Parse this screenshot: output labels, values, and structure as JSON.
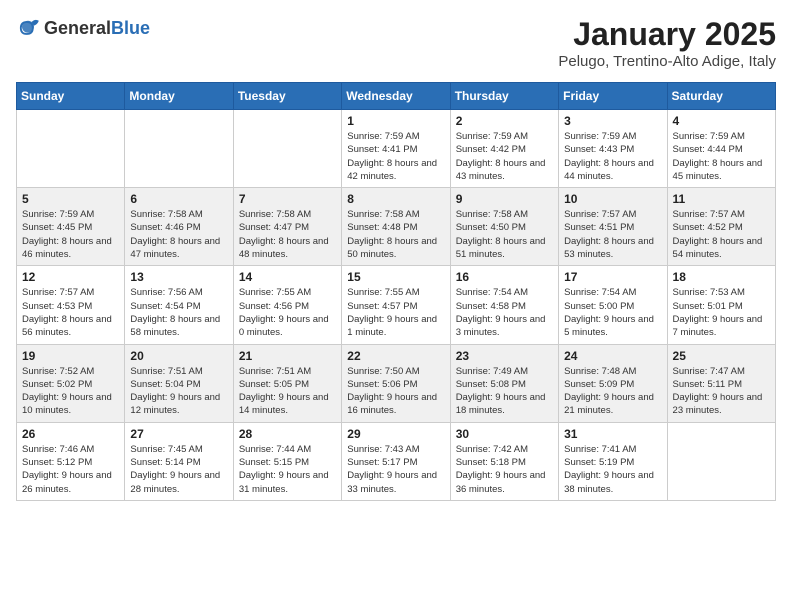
{
  "header": {
    "logo_general": "General",
    "logo_blue": "Blue",
    "month": "January 2025",
    "location": "Pelugo, Trentino-Alto Adige, Italy"
  },
  "weekdays": [
    "Sunday",
    "Monday",
    "Tuesday",
    "Wednesday",
    "Thursday",
    "Friday",
    "Saturday"
  ],
  "weeks": [
    {
      "days": [
        {
          "num": "",
          "info": ""
        },
        {
          "num": "",
          "info": ""
        },
        {
          "num": "",
          "info": ""
        },
        {
          "num": "1",
          "info": "Sunrise: 7:59 AM\nSunset: 4:41 PM\nDaylight: 8 hours and 42 minutes."
        },
        {
          "num": "2",
          "info": "Sunrise: 7:59 AM\nSunset: 4:42 PM\nDaylight: 8 hours and 43 minutes."
        },
        {
          "num": "3",
          "info": "Sunrise: 7:59 AM\nSunset: 4:43 PM\nDaylight: 8 hours and 44 minutes."
        },
        {
          "num": "4",
          "info": "Sunrise: 7:59 AM\nSunset: 4:44 PM\nDaylight: 8 hours and 45 minutes."
        }
      ]
    },
    {
      "days": [
        {
          "num": "5",
          "info": "Sunrise: 7:59 AM\nSunset: 4:45 PM\nDaylight: 8 hours and 46 minutes."
        },
        {
          "num": "6",
          "info": "Sunrise: 7:58 AM\nSunset: 4:46 PM\nDaylight: 8 hours and 47 minutes."
        },
        {
          "num": "7",
          "info": "Sunrise: 7:58 AM\nSunset: 4:47 PM\nDaylight: 8 hours and 48 minutes."
        },
        {
          "num": "8",
          "info": "Sunrise: 7:58 AM\nSunset: 4:48 PM\nDaylight: 8 hours and 50 minutes."
        },
        {
          "num": "9",
          "info": "Sunrise: 7:58 AM\nSunset: 4:50 PM\nDaylight: 8 hours and 51 minutes."
        },
        {
          "num": "10",
          "info": "Sunrise: 7:57 AM\nSunset: 4:51 PM\nDaylight: 8 hours and 53 minutes."
        },
        {
          "num": "11",
          "info": "Sunrise: 7:57 AM\nSunset: 4:52 PM\nDaylight: 8 hours and 54 minutes."
        }
      ]
    },
    {
      "days": [
        {
          "num": "12",
          "info": "Sunrise: 7:57 AM\nSunset: 4:53 PM\nDaylight: 8 hours and 56 minutes."
        },
        {
          "num": "13",
          "info": "Sunrise: 7:56 AM\nSunset: 4:54 PM\nDaylight: 8 hours and 58 minutes."
        },
        {
          "num": "14",
          "info": "Sunrise: 7:55 AM\nSunset: 4:56 PM\nDaylight: 9 hours and 0 minutes."
        },
        {
          "num": "15",
          "info": "Sunrise: 7:55 AM\nSunset: 4:57 PM\nDaylight: 9 hours and 1 minute."
        },
        {
          "num": "16",
          "info": "Sunrise: 7:54 AM\nSunset: 4:58 PM\nDaylight: 9 hours and 3 minutes."
        },
        {
          "num": "17",
          "info": "Sunrise: 7:54 AM\nSunset: 5:00 PM\nDaylight: 9 hours and 5 minutes."
        },
        {
          "num": "18",
          "info": "Sunrise: 7:53 AM\nSunset: 5:01 PM\nDaylight: 9 hours and 7 minutes."
        }
      ]
    },
    {
      "days": [
        {
          "num": "19",
          "info": "Sunrise: 7:52 AM\nSunset: 5:02 PM\nDaylight: 9 hours and 10 minutes."
        },
        {
          "num": "20",
          "info": "Sunrise: 7:51 AM\nSunset: 5:04 PM\nDaylight: 9 hours and 12 minutes."
        },
        {
          "num": "21",
          "info": "Sunrise: 7:51 AM\nSunset: 5:05 PM\nDaylight: 9 hours and 14 minutes."
        },
        {
          "num": "22",
          "info": "Sunrise: 7:50 AM\nSunset: 5:06 PM\nDaylight: 9 hours and 16 minutes."
        },
        {
          "num": "23",
          "info": "Sunrise: 7:49 AM\nSunset: 5:08 PM\nDaylight: 9 hours and 18 minutes."
        },
        {
          "num": "24",
          "info": "Sunrise: 7:48 AM\nSunset: 5:09 PM\nDaylight: 9 hours and 21 minutes."
        },
        {
          "num": "25",
          "info": "Sunrise: 7:47 AM\nSunset: 5:11 PM\nDaylight: 9 hours and 23 minutes."
        }
      ]
    },
    {
      "days": [
        {
          "num": "26",
          "info": "Sunrise: 7:46 AM\nSunset: 5:12 PM\nDaylight: 9 hours and 26 minutes."
        },
        {
          "num": "27",
          "info": "Sunrise: 7:45 AM\nSunset: 5:14 PM\nDaylight: 9 hours and 28 minutes."
        },
        {
          "num": "28",
          "info": "Sunrise: 7:44 AM\nSunset: 5:15 PM\nDaylight: 9 hours and 31 minutes."
        },
        {
          "num": "29",
          "info": "Sunrise: 7:43 AM\nSunset: 5:17 PM\nDaylight: 9 hours and 33 minutes."
        },
        {
          "num": "30",
          "info": "Sunrise: 7:42 AM\nSunset: 5:18 PM\nDaylight: 9 hours and 36 minutes."
        },
        {
          "num": "31",
          "info": "Sunrise: 7:41 AM\nSunset: 5:19 PM\nDaylight: 9 hours and 38 minutes."
        },
        {
          "num": "",
          "info": ""
        }
      ]
    }
  ]
}
